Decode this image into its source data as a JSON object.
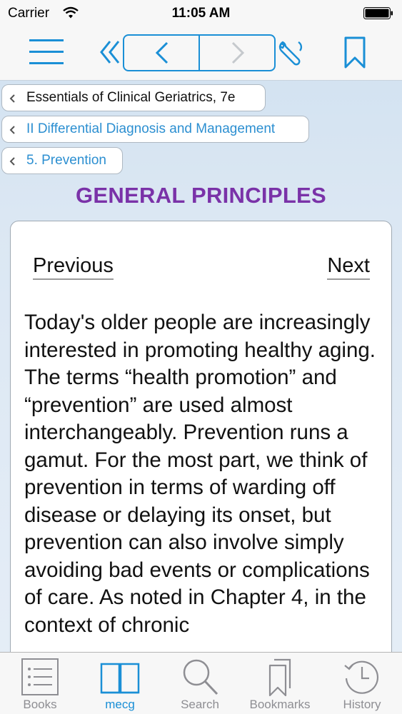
{
  "status_bar": {
    "carrier": "Carrier",
    "time": "11:05 AM"
  },
  "toolbar": {
    "icons": [
      "menu-icon",
      "back-all-icon",
      "previous-page-icon",
      "next-page-icon",
      "wrench-icon",
      "bookmark-icon"
    ]
  },
  "breadcrumbs": [
    {
      "label": "Essentials of Clinical Geriatrics, 7e"
    },
    {
      "label": "II Differential Diagnosis and Management"
    },
    {
      "label": "5. Prevention"
    }
  ],
  "section_title": "GENERAL PRINCIPLES",
  "content": {
    "previous_label": "Previous",
    "next_label": "Next",
    "body": "Today's older people are increasingly interested in promoting healthy aging. The terms “health promotion” and “prevention” are used almost interchangeably. Prevention runs a gamut. For the most part, we think of prevention in terms of warding off disease or delaying its onset, but prevention can also involve simply avoiding bad events or complications of care. As noted in Chapter 4, in the context of chronic"
  },
  "tab_bar": {
    "tabs": [
      {
        "label": "Books",
        "icon": "list-icon",
        "active": false
      },
      {
        "label": "mecg",
        "icon": "open-book-icon",
        "active": true
      },
      {
        "label": "Search",
        "icon": "search-icon",
        "active": false
      },
      {
        "label": "Bookmarks",
        "icon": "bookmarks-icon",
        "active": false
      },
      {
        "label": "History",
        "icon": "clock-icon",
        "active": false
      }
    ]
  },
  "colors": {
    "accent": "#1a8fd6",
    "title": "#7a32a8",
    "link": "#2c8fd1",
    "inactive_tab": "#8e8e93"
  }
}
